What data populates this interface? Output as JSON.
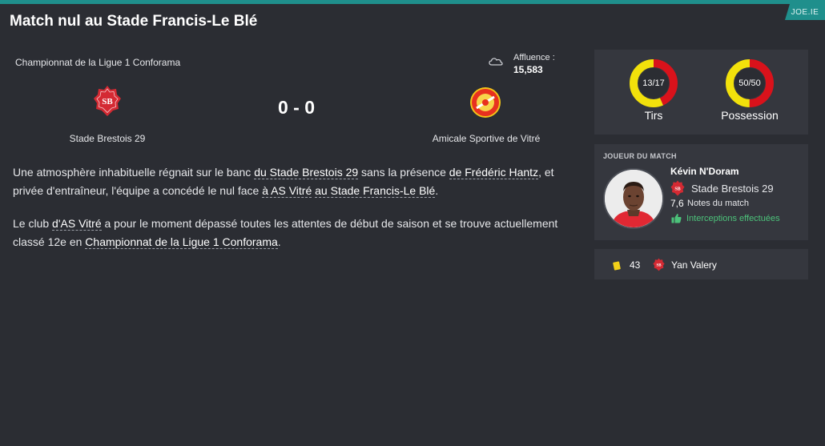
{
  "header": {
    "title": "Match nul au Stade Francis-Le Blé",
    "badge": "JOE.IE"
  },
  "match": {
    "competition": "Championnat de la Ligue 1 Conforama",
    "attendance_label": "Affluence :",
    "attendance": "15,583",
    "weather_icon": "cloudy-icon",
    "score": "0 - 0",
    "home_team": "Stade Brestois 29",
    "away_team": "Amicale Sportive de Vitré"
  },
  "report": {
    "p1": [
      {
        "t": "Une atmosphère inhabituelle régnait sur le banc ",
        "link": false
      },
      {
        "t": "du Stade Brestois 29",
        "link": true
      },
      {
        "t": " sans la présence ",
        "link": false
      },
      {
        "t": "de Frédéric Hantz",
        "link": true
      },
      {
        "t": ", et privée d'entraîneur, l'équipe a concédé le nul face ",
        "link": false
      },
      {
        "t": "à AS Vitré",
        "link": true
      },
      {
        "t": " ",
        "link": false
      },
      {
        "t": "au Stade Francis-Le Blé",
        "link": true
      },
      {
        "t": ".",
        "link": false
      }
    ],
    "p2": [
      {
        "t": "Le club ",
        "link": false
      },
      {
        "t": "d'AS Vitré",
        "link": true
      },
      {
        "t": " a pour le moment dépassé toutes les attentes de début de saison et se trouve actuellement classé 12e en ",
        "link": false
      },
      {
        "t": "Championnat de la Ligue 1 Conforama",
        "link": true
      },
      {
        "t": ".",
        "link": false
      }
    ]
  },
  "stats": {
    "shots": {
      "label": "Tirs",
      "text": "13/17",
      "home": 13,
      "away": 17
    },
    "possession": {
      "label": "Possession",
      "text": "50/50",
      "home": 50,
      "away": 50
    },
    "colors": {
      "home": "#d9121b",
      "away": "#f2e10b"
    }
  },
  "player_of_match": {
    "heading": "JOUEUR DU MATCH",
    "name": "Kévin N'Doram",
    "club": "Stade Brestois 29",
    "rating": "7,6",
    "rating_label": "Notes du match",
    "highlight": "Interceptions effectuées"
  },
  "events": [
    {
      "type": "yellow-card",
      "minute": "43",
      "player": "Yan Valery"
    }
  ]
}
